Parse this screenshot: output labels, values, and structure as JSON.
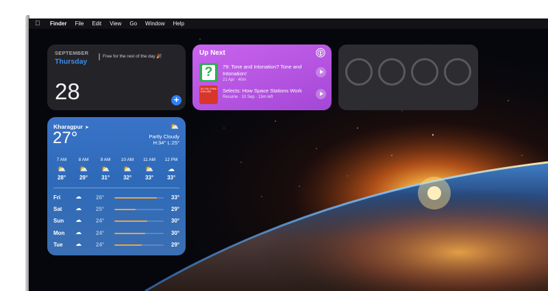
{
  "menubar": {
    "apple_icon": "apple-logo-icon",
    "items": [
      "Finder",
      "File",
      "Edit",
      "View",
      "Go",
      "Window",
      "Help"
    ]
  },
  "calendar": {
    "month": "SEPTEMBER",
    "weekday": "Thursday",
    "day": "28",
    "event": "Free for the rest of the day 🎉",
    "add_icon": "plus-icon",
    "accent_color": "#3b8cf0"
  },
  "podcasts": {
    "header": "Up Next",
    "header_icon": "podcasts-icon",
    "episodes": [
      {
        "art_letter": "?",
        "title": "79: Tone and Intonation? Tone and Intonation!",
        "meta": "21 Apr · 40m"
      },
      {
        "art_text": "DO YOU THINK / EXPLORE",
        "title": "Selects: How Space Stations Work",
        "meta": "Resume · 10 Sep · 15m left"
      }
    ],
    "play_icon": "play-icon",
    "background_color": "#b955e4"
  },
  "batteries": {
    "ring_count": 4,
    "ring_icon": "battery-ring-icon"
  },
  "weather": {
    "city": "Kharagpur",
    "location_icon": "location-arrow-icon",
    "temp": "27°",
    "condition_icon": "partly-cloudy-icon",
    "condition": "Partly Cloudy",
    "high_low": "H:34° L:25°",
    "hourly": [
      {
        "time": "7 AM",
        "icon": "partly-cloudy-icon",
        "temp": "28°"
      },
      {
        "time": "8 AM",
        "icon": "partly-cloudy-icon",
        "temp": "29°"
      },
      {
        "time": "9 AM",
        "icon": "partly-cloudy-icon",
        "temp": "31°"
      },
      {
        "time": "10 AM",
        "icon": "partly-cloudy-icon",
        "temp": "32°"
      },
      {
        "time": "11 AM",
        "icon": "partly-cloudy-icon",
        "temp": "33°"
      },
      {
        "time": "12 PM",
        "icon": "cloud-icon",
        "temp": "33°"
      }
    ],
    "daily": [
      {
        "day": "Fri",
        "icon": "cloud-icon",
        "low": "26°",
        "high": "33°",
        "range_start": 0.0,
        "range_end": 0.86
      },
      {
        "day": "Sat",
        "icon": "cloud-icon",
        "low": "25°",
        "high": "29°",
        "range_start": 0.0,
        "range_end": 0.43
      },
      {
        "day": "Sun",
        "icon": "cloud-icon",
        "low": "24°",
        "high": "30°",
        "range_start": 0.0,
        "range_end": 0.67
      },
      {
        "day": "Mon",
        "icon": "cloud-icon",
        "low": "24°",
        "high": "30°",
        "range_start": 0.0,
        "range_end": 0.63
      },
      {
        "day": "Tue",
        "icon": "cloud-icon",
        "low": "24°",
        "high": "29°",
        "range_start": 0.0,
        "range_end": 0.55
      }
    ],
    "bar_color": "#f2a23a"
  }
}
